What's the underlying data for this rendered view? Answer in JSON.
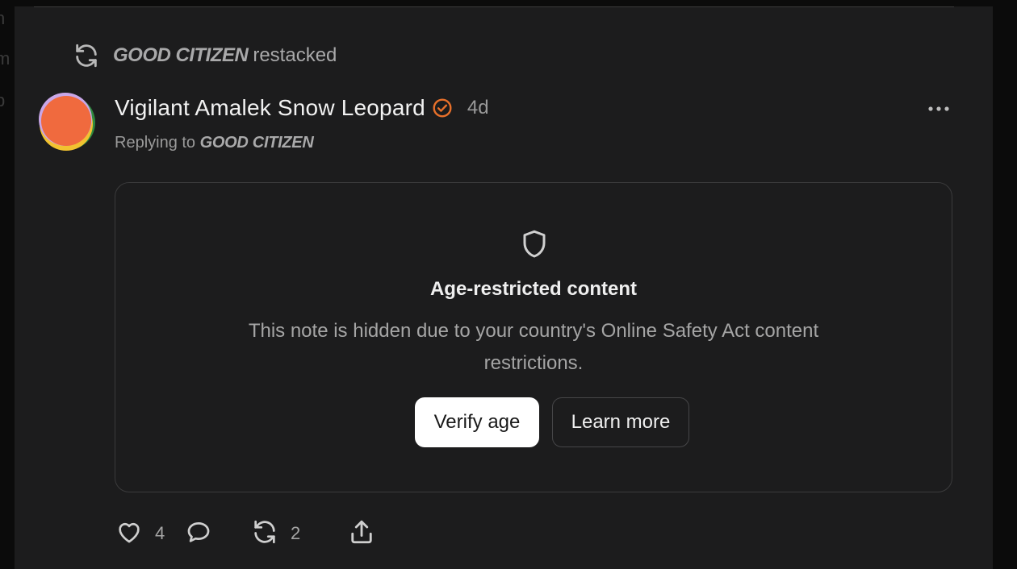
{
  "restack": {
    "user": "GOOD CITIZEN",
    "verb": "restacked",
    "icon": "restack-icon"
  },
  "post": {
    "author": "Vigilant Amalek Snow Leopard",
    "verified_icon": "verified-badge-icon",
    "age": "4d",
    "replying_prefix": "Replying to",
    "replying_to": "GOOD CITIZEN",
    "more_icon": "more-options-icon"
  },
  "restricted": {
    "icon": "shield-icon",
    "title": "Age-restricted content",
    "description": "This note is hidden due to your country's Online Safety Act content restrictions.",
    "verify_label": "Verify age",
    "learn_label": "Learn more"
  },
  "actions": {
    "likes": "4",
    "restacks": "2"
  },
  "colors": {
    "background": "#1c1c1d",
    "accent": "#e8702a",
    "border": "#3b3b3c",
    "button_primary": "#ffffff"
  }
}
